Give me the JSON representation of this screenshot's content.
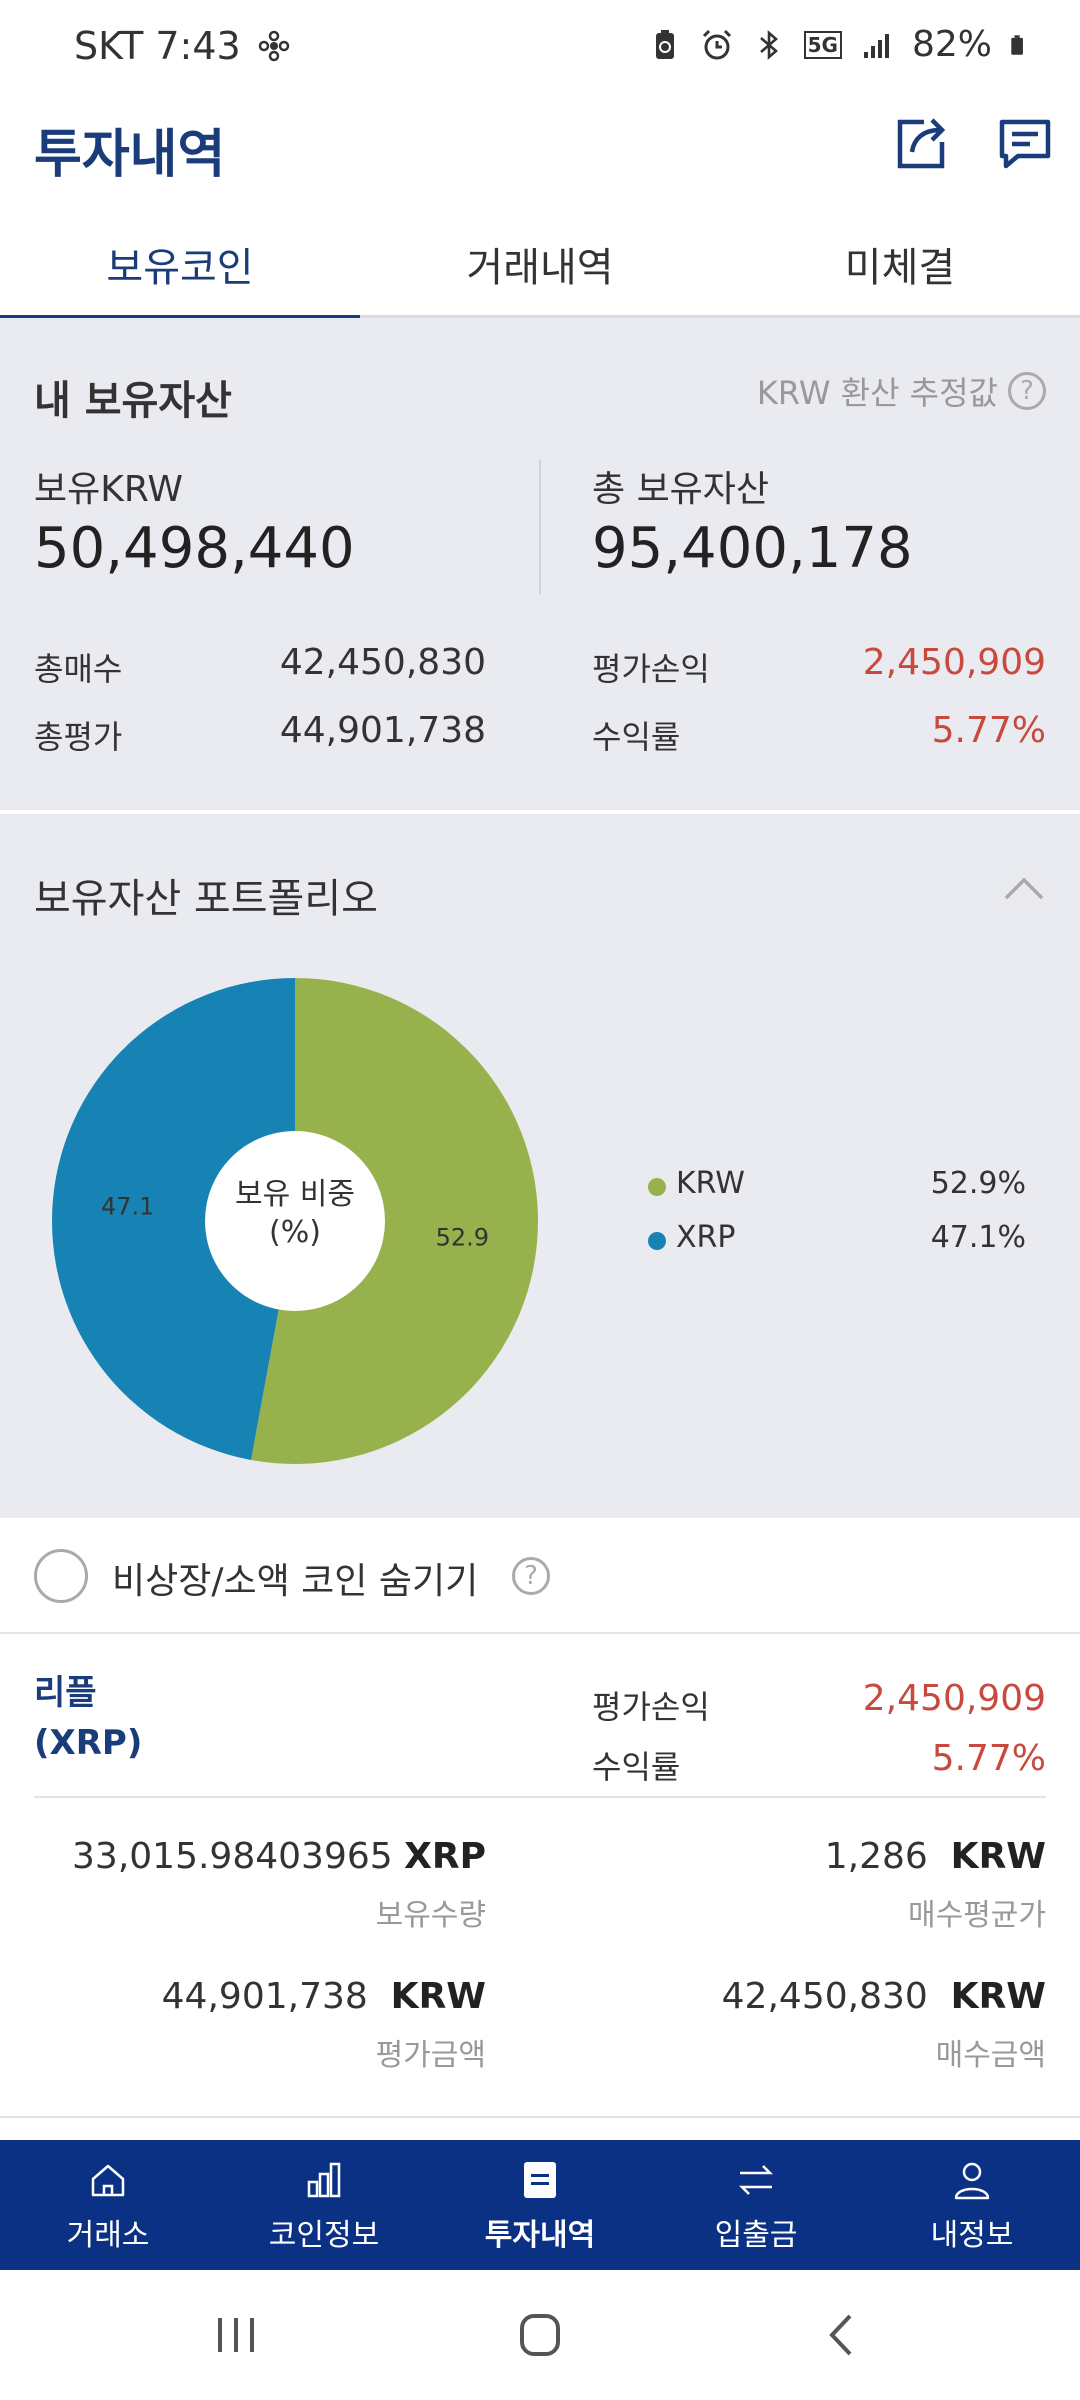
{
  "status_bar": {
    "carrier_time": "SKT 7:43",
    "network": "5G",
    "battery": "82%"
  },
  "header": {
    "title": "투자내역",
    "share_icon": "share-icon",
    "message_icon": "message-icon"
  },
  "tabs": [
    {
      "label": "보유코인",
      "active": true
    },
    {
      "label": "거래내역",
      "active": false
    },
    {
      "label": "미체결",
      "active": false
    }
  ],
  "assets": {
    "title": "내 보유자산",
    "krw_note": "KRW 환산 추정값",
    "krw_label": "보유KRW",
    "krw_value": "50,498,440",
    "total_label": "총 보유자산",
    "total_value": "95,400,178",
    "buy_total_label": "총매수",
    "buy_total_value": "42,450,830",
    "eval_total_label": "총평가",
    "eval_total_value": "44,901,738",
    "pnl_label": "평가손익",
    "pnl_value": "2,450,909",
    "rate_label": "수익률",
    "rate_value": "5.77%"
  },
  "portfolio": {
    "title": "보유자산 포트폴리오",
    "center_line1": "보유 비중",
    "center_line2": "(%)",
    "legend": [
      {
        "name": "KRW",
        "value": "52.9%",
        "color": "#97b14d"
      },
      {
        "name": "XRP",
        "value": "47.1%",
        "color": "#1783b4"
      }
    ]
  },
  "chart_data": {
    "type": "pie",
    "categories": [
      "KRW",
      "XRP"
    ],
    "values": [
      52.9,
      47.1
    ],
    "labels": [
      "52.9",
      "47.1"
    ],
    "colors": [
      "#97b14d",
      "#1783b4"
    ],
    "donut": true
  },
  "hide_toggle": {
    "label": "비상장/소액 코인 숨기기",
    "checked": false
  },
  "coin": {
    "name_line1": "리플",
    "name_line2": "(XRP)",
    "pnl_label": "평가손익",
    "pnl_value": "2,450,909",
    "rate_label": "수익률",
    "rate_value": "5.77%",
    "qty_value": "33,015.98403965",
    "qty_unit": "XRP",
    "qty_label": "보유수량",
    "avg_value": "1,286",
    "avg_unit": "KRW",
    "avg_label": "매수평균가",
    "eval_value": "44,901,738",
    "eval_unit": "KRW",
    "eval_label": "평가금액",
    "buy_value": "42,450,830",
    "buy_unit": "KRW",
    "buy_label": "매수금액"
  },
  "bottom_nav": [
    {
      "label": "거래소",
      "icon": "home-icon",
      "active": false
    },
    {
      "label": "코인정보",
      "icon": "bar-chart-icon",
      "active": false
    },
    {
      "label": "투자내역",
      "icon": "list-icon",
      "active": true
    },
    {
      "label": "입출금",
      "icon": "transfer-icon",
      "active": false
    },
    {
      "label": "내정보",
      "icon": "user-icon",
      "active": false
    }
  ]
}
